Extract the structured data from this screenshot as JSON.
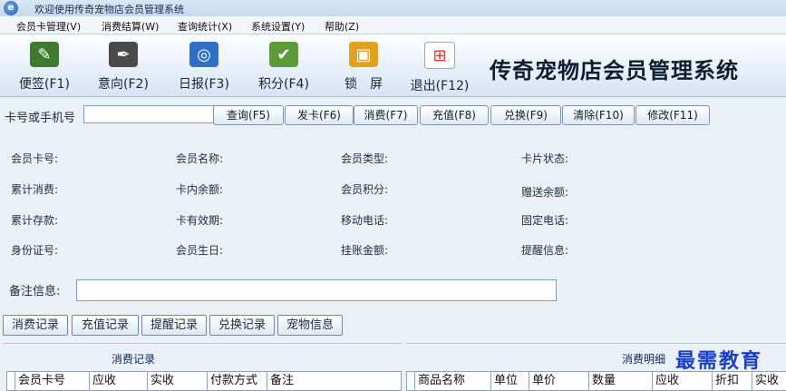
{
  "window": {
    "title": "欢迎使用传奇宠物店会员管理系统"
  },
  "menu": [
    "会员卡管理(V)",
    "消费结算(W)",
    "查询统计(X)",
    "系统设置(Y)",
    "帮助(Z)"
  ],
  "toolbar": {
    "buttons": [
      {
        "label": "便签(F1)",
        "icon": "note-pencil-icon"
      },
      {
        "label": "意向(F2)",
        "icon": "intent-pen-icon"
      },
      {
        "label": "日报(F3)",
        "icon": "daily-report-icon"
      },
      {
        "label": "积分(F4)",
        "icon": "points-icon"
      },
      {
        "label": "锁　屏",
        "icon": "lock-screen-icon"
      },
      {
        "label": "退出(F12)",
        "icon": "exit-icon"
      }
    ],
    "brand_title": "传奇宠物店会员管理系统"
  },
  "search": {
    "label": "卡号或手机号",
    "value": "",
    "buttons": [
      "查询(F5)",
      "发卡(F6)",
      "消费(F7)",
      "充值(F8)",
      "兑换(F9)",
      "清除(F10)",
      "修改(F11)"
    ]
  },
  "info_fields": [
    "会员卡号:",
    "会员名称:",
    "会员类型:",
    "卡片状态:",
    "累计消费:",
    "卡内余额:",
    "会员积分:",
    "赠送余额:",
    "累计存款:",
    "卡有效期:",
    "移动电话:",
    "固定电话:",
    "身份证号:",
    "会员生日:",
    "挂账金额:",
    "提醒信息:"
  ],
  "remark": {
    "label": "备注信息:",
    "value": ""
  },
  "tabs": [
    "消费记录",
    "充值记录",
    "提醒记录",
    "兑换记录",
    "宠物信息"
  ],
  "records": {
    "left_caption": "消费记录",
    "left_columns": [
      "会员卡号",
      "应收",
      "实收",
      "付款方式",
      "备注"
    ],
    "right_caption": "消费明细",
    "right_columns": [
      "商品名称",
      "单位",
      "单价",
      "数量",
      "应收",
      "折扣",
      "实收"
    ]
  },
  "watermark": "最需教育",
  "colors": {
    "brand_text": "#0f1d33",
    "watermark": "#1a3fc7"
  }
}
